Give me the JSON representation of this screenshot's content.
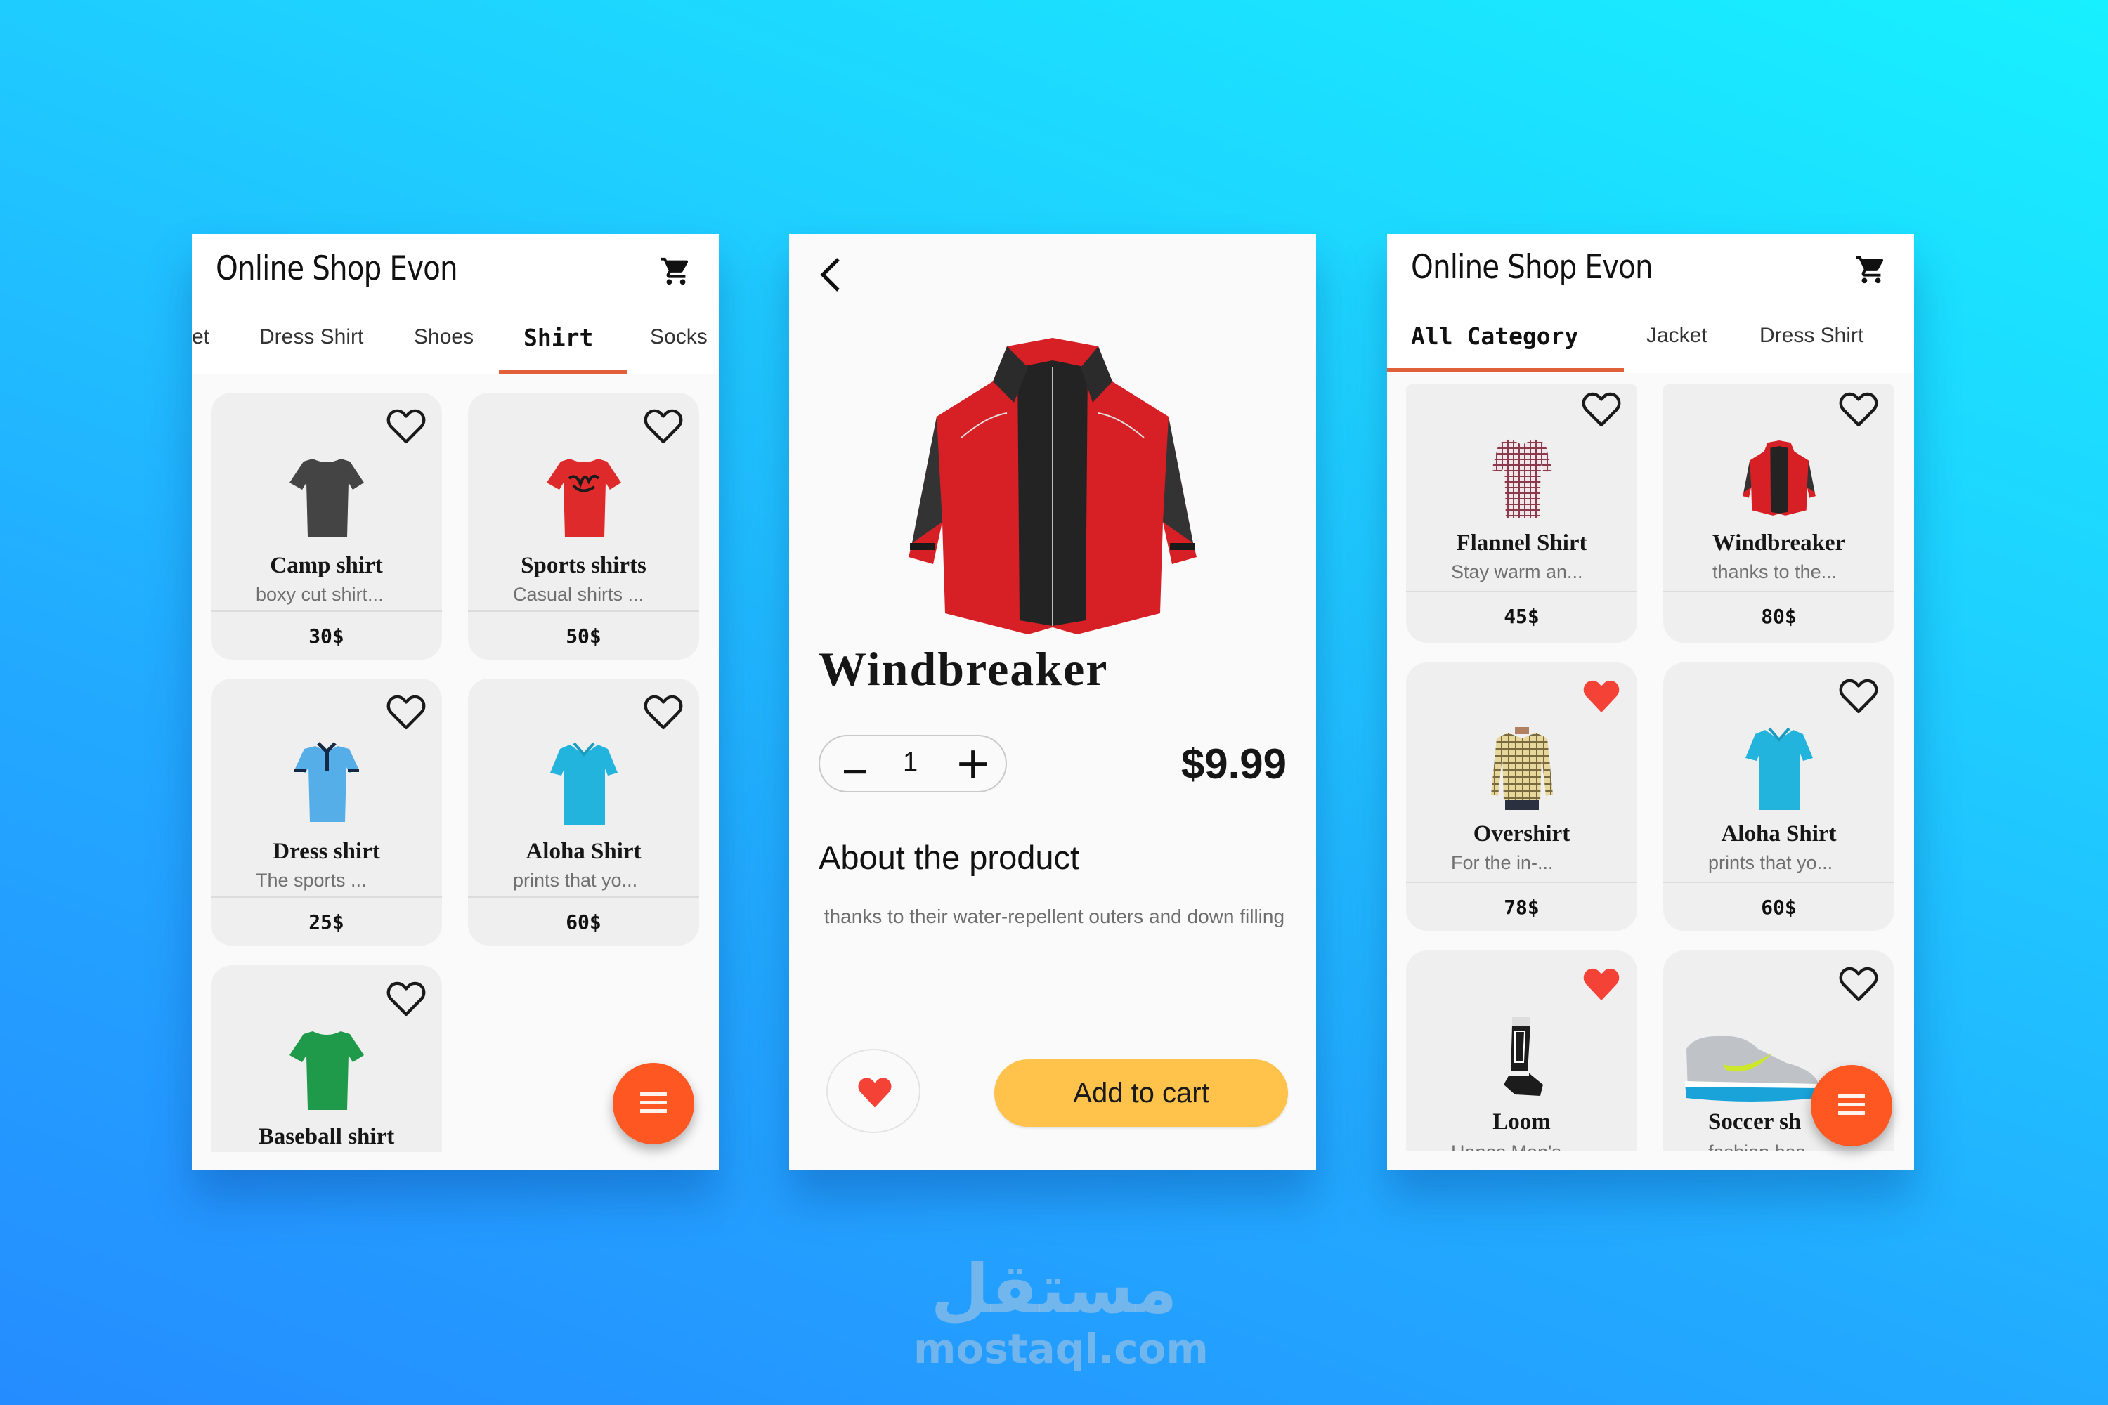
{
  "colors": {
    "accent": "#e0603a",
    "fab": "#ff5722",
    "favorite": "#f44336",
    "add_to_cart": "#ffc24a",
    "card_bg": "#efefef",
    "bg_gradient": [
      "#17f0ff",
      "#258cff"
    ]
  },
  "icons": {
    "cart": "shopping-cart-icon",
    "heart_outline": "heart-outline-icon",
    "heart_filled": "heart-filled-icon",
    "menu": "menu-icon",
    "back": "chevron-left-icon",
    "minus": "minus-icon",
    "plus": "plus-icon"
  },
  "left_screen": {
    "title": "Online Shop Evon",
    "tabs": [
      {
        "label": "et",
        "active": false
      },
      {
        "label": "Dress Shirt",
        "active": false
      },
      {
        "label": "Shoes",
        "active": false
      },
      {
        "label": "Shirt",
        "active": true
      },
      {
        "label": "Socks",
        "active": false
      }
    ],
    "products": [
      {
        "name": "Camp shirt",
        "desc": "boxy cut shirt...",
        "price": "30$",
        "favorite": false,
        "image": "dark-gray-tshirt"
      },
      {
        "name": "Sports shirts",
        "desc": "Casual shirts ...",
        "price": "50$",
        "favorite": false,
        "image": "red-graphic-tshirt"
      },
      {
        "name": "Dress shirt",
        "desc": "The sports ...",
        "price": "25$",
        "favorite": false,
        "image": "light-blue-polo"
      },
      {
        "name": "Aloha Shirt",
        "desc": "prints that yo...",
        "price": "60$",
        "favorite": false,
        "image": "cyan-polo"
      },
      {
        "name": "Baseball shirt",
        "desc": "",
        "price": "",
        "favorite": false,
        "image": "green-tshirt"
      }
    ]
  },
  "detail_screen": {
    "product_name": "Windbreaker",
    "quantity": "1",
    "price": "$9.99",
    "about_heading": "About the product",
    "about_text": " thanks to their water-repellent outers and down filling",
    "favorite": true,
    "add_to_cart_label": "Add to cart",
    "image": "red-windbreaker-jacket"
  },
  "right_screen": {
    "title": "Online Shop Evon",
    "tabs": [
      {
        "label": "All Category",
        "active": true
      },
      {
        "label": "Jacket",
        "active": false
      },
      {
        "label": "Dress Shirt",
        "active": false
      }
    ],
    "products": [
      {
        "name": "Flannel Shirt",
        "desc": "Stay warm an...",
        "price": "45$",
        "favorite": false,
        "image": "plaid-shirt"
      },
      {
        "name": "Windbreaker",
        "desc": "thanks to the...",
        "price": "80$",
        "favorite": false,
        "image": "red-windbreaker-jacket"
      },
      {
        "name": "Overshirt",
        "desc": "For the in-...",
        "price": "78$",
        "favorite": true,
        "image": "yellow-plaid-overshirt"
      },
      {
        "name": "Aloha Shirt",
        "desc": "prints that yo...",
        "price": "60$",
        "favorite": false,
        "image": "cyan-polo"
      },
      {
        "name": "Loom",
        "desc": "Hanes Men's",
        "price": "",
        "favorite": true,
        "image": "black-sock"
      },
      {
        "name": "Soccer sh",
        "desc": "fashion has",
        "price": "",
        "favorite": false,
        "image": "running-shoe"
      }
    ]
  },
  "watermark": {
    "arabic": "مستقل",
    "latin": "mostaql.com"
  }
}
